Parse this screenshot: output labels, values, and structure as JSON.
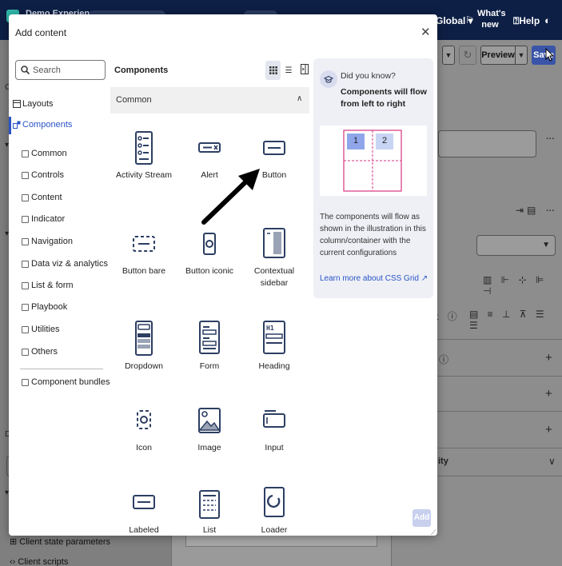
{
  "app": {
    "name": "Demo Experience",
    "global_label": "Global ▾",
    "whats_new": [
      "What's",
      "new"
    ],
    "help_label": "Help",
    "toolbar": {
      "preview": "Preview",
      "save": "Save"
    },
    "right_panel": {
      "section_title": "ity"
    },
    "left_panel": {
      "items": [
        "Client state parameters",
        "Client scripts"
      ]
    }
  },
  "dialog": {
    "title": "Add content",
    "search_placeholder": "Search",
    "tree": [
      {
        "label": "Layouts",
        "icon": "layout-icon"
      },
      {
        "label": "Components",
        "icon": "components-icon",
        "active": true
      }
    ],
    "categories": [
      "Common",
      "Controls",
      "Content",
      "Indicator",
      "Navigation",
      "Data viz & analytics",
      "List & form",
      "Playbook",
      "Utilities",
      "Others"
    ],
    "bundles_label": "Component bundles",
    "components_header": "Components",
    "group": "Common",
    "components": [
      {
        "label": "Activity Stream",
        "icon": "activity-stream-icon"
      },
      {
        "label": "Alert",
        "icon": "alert-icon"
      },
      {
        "label": "Button",
        "icon": "button-icon"
      },
      {
        "label": "Button bare",
        "icon": "button-bare-icon"
      },
      {
        "label": "Button iconic",
        "icon": "button-iconic-icon"
      },
      {
        "label": "Contextual sidebar",
        "icon": "contextual-sidebar-icon"
      },
      {
        "label": "Dropdown",
        "icon": "dropdown-icon"
      },
      {
        "label": "Form",
        "icon": "form-icon"
      },
      {
        "label": "Heading",
        "icon": "heading-icon"
      },
      {
        "label": "Icon",
        "icon": "icon-icon"
      },
      {
        "label": "Image",
        "icon": "image-icon"
      },
      {
        "label": "Input",
        "icon": "input-icon"
      },
      {
        "label": "Labeled",
        "icon": "labeled-icon"
      },
      {
        "label": "List",
        "icon": "list-icon"
      },
      {
        "label": "Loader",
        "icon": "loader-icon"
      }
    ],
    "info": {
      "kicker": "Did you know?",
      "headline": "Components will flow from left to right",
      "cells": [
        "1",
        "2"
      ],
      "body": "The components will flow as shown in the illustration in this column/container with the current configurations",
      "link": "Learn more about CSS Grid"
    },
    "add_button": "Add",
    "colors": {
      "accent": "#2a53c7",
      "highlight": "#d6357f",
      "icon_stroke": "#2c3e63"
    }
  }
}
